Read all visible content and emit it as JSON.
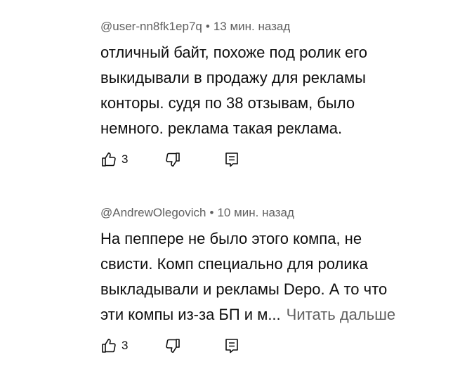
{
  "comments": [
    {
      "author": "@user-nn8fk1ep7q",
      "separator": "•",
      "time": "13 мин. назад",
      "lines": [
        "отличный байт, похоже под ролик его",
        "выкидывали в продажу для рекламы",
        "конторы. судя по 38 отзывам, было",
        "немного. реклама такая реклама."
      ],
      "read_more": "",
      "likes": "3",
      "icons": {
        "like": "thumb-up-icon",
        "dislike": "thumb-down-icon",
        "reply": "reply-icon"
      }
    },
    {
      "author": "@AndrewOlegovich",
      "separator": "•",
      "time": "10 мин. назад",
      "lines": [
        "На пеппере не было этого компа, не",
        "свисти. Комп специально для ролика",
        "выкладывали и рекламы Depo. А то что",
        "эти компы из-за БП и м..."
      ],
      "read_more": "Читать дальше",
      "likes": "3",
      "icons": {
        "like": "thumb-up-icon",
        "dislike": "thumb-down-icon",
        "reply": "reply-icon"
      }
    }
  ],
  "colors": {
    "text": "#0f0f0f",
    "secondary": "#606060",
    "background": "#ffffff"
  }
}
